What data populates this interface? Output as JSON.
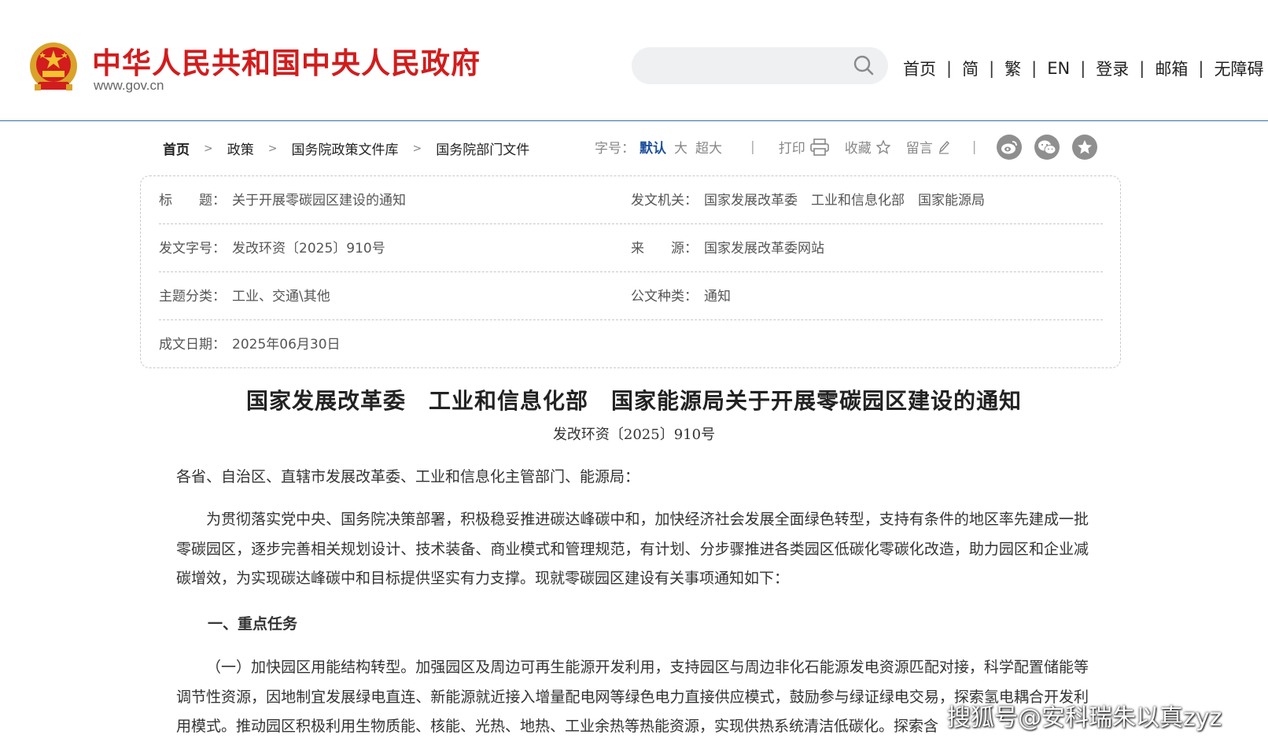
{
  "header": {
    "site_title": "中华人民共和国中央人民政府",
    "site_url": "www.gov.cn",
    "search_placeholder": "",
    "nav": [
      "首页",
      "简",
      "繁",
      "EN",
      "登录",
      "邮箱",
      "无障碍"
    ],
    "nav_separator": "|"
  },
  "breadcrumb": {
    "items": [
      "首页",
      "政策",
      "国务院政策文件库",
      "国务院部门文件"
    ],
    "separator": ">"
  },
  "toolbar": {
    "font_size_label": "字号：",
    "font_default": "默认",
    "font_large": "大",
    "font_xlarge": "超大",
    "print_label": "打印",
    "favorite_label": "收藏",
    "comment_label": "留言",
    "divider": "|"
  },
  "share_icons": [
    "weibo-icon",
    "wechat-icon",
    "star-badge-icon"
  ],
  "info": {
    "title_label": "标　　题：",
    "title_value": "关于开展零碳园区建设的通知",
    "issuer_label": "发文机关：",
    "issuer_value": "国家发展改革委　工业和信息化部　国家能源局",
    "doc_no_label": "发文字号：",
    "doc_no_value": "发改环资〔2025〕910号",
    "source_label": "来　　源：",
    "source_value": "国家发展改革委网站",
    "category_label": "主题分类：",
    "category_value": "工业、交通\\其他",
    "type_label": "公文种类：",
    "type_value": "通知",
    "date_label": "成文日期：",
    "date_value": "2025年06月30日"
  },
  "article": {
    "title": "国家发展改革委　工业和信息化部　国家能源局关于开展零碳园区建设的通知",
    "doc_no": "发改环资〔2025〕910号",
    "addressees": "各省、自治区、直辖市发展改革委、工业和信息化主管部门、能源局：",
    "para1": "为贯彻落实党中央、国务院决策部署，积极稳妥推进碳达峰碳中和，加快经济社会发展全面绿色转型，支持有条件的地区率先建成一批零碳园区，逐步完善相关规划设计、技术装备、商业模式和管理规范，有计划、分步骤推进各类园区低碳化零碳化改造，助力园区和企业减碳增效，为实现碳达峰碳中和目标提供坚实有力支撑。现就零碳园区建设有关事项通知如下：",
    "section1": "一、重点任务",
    "para2": "（一）加快园区用能结构转型。加强园区及周边可再生能源开发利用，支持园区与周边非化石能源发电资源匹配对接，科学配置储能等调节性资源，因地制宜发展绿电直连、新能源就近接入增量配电网等绿色电力直接供应模式，鼓励参与绿证绿电交易，探索氢电耦合开发利用模式。推动园区积极利用生物质能、核能、光热、地热、工业余热等热能资源，实现供热系统清洁低碳化。探索含"
  },
  "watermark": "搜狐号@安科瑞朱以真zyz",
  "colors": {
    "brand_red": "#d11d1d",
    "link_blue": "#1d4f9c",
    "header_border": "#3a6ea8"
  }
}
